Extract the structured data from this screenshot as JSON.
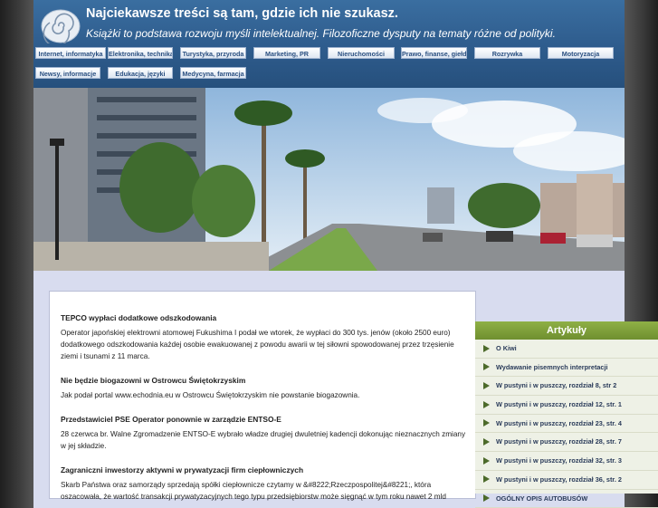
{
  "header": {
    "title": "Najciekawsze treści są tam, gdzie ich nie szukasz.",
    "tagline": "Książki to podstawa rozwoju myśli intelektualnej. Filozoficzne dysputy na tematy różne od polityki.",
    "nav_row1": [
      "Internet, informatyka",
      "Elektronika, technika",
      "Turystyka, przyroda",
      "Marketing, PR",
      "Nieruchomości",
      "Prawo, finanse, giełda",
      "Rozrywka",
      "Motoryzacja"
    ],
    "nav_row2": [
      "Newsy, informacje",
      "Edukacja, języki",
      "Medycyna, farmacja"
    ]
  },
  "articles": [
    {
      "title": "TEPCO wypłaci dodatkowe odszkodowania",
      "body": "Operator japońskiej elektrowni atomowej Fukushima I podał we wtorek, że wypłaci do 300 tys. jenów (około 2500 euro) dodatkowego odszkodowania każdej osobie ewakuowanej z powodu awarii w tej siłowni spowodowanej przez trzęsienie ziemi i tsunami z 11 marca."
    },
    {
      "title": "Nie będzie biogazowni w Ostrowcu Świętokrzyskim",
      "body": "Jak podał portal www.echodnia.eu w Ostrowcu Świętokrzyskim nie powstanie biogazownia."
    },
    {
      "title": "Przedstawiciel PSE Operator ponownie w zarządzie ENTSO-E",
      "body": "28 czerwca br. Walne Zgromadzenie ENTSO-E wybrało władze drugiej dwuletniej kadencji dokonując nieznacznych zmiany w jej składzie."
    },
    {
      "title": "Zagraniczni inwestorzy aktywni w prywatyzacji firm ciepłowniczych",
      "body": "Skarb Państwa oraz samorządy sprzedają spółki ciepłownicze czytamy w &#8222;Rzeczpospolitej&#8221;, która oszacowała, że wartość transakcji prywatyzacyjnych tego typu przedsiębiorstw może sięgnąć w tym roku nawet 2 mld"
    }
  ],
  "sidebar": {
    "heading": "Artykuły",
    "items": [
      "O Kiwi",
      "Wydawanie pisemnych interpretacji",
      "W pustyni i w puszczy, rozdział 8, str 2",
      "W pustyni i w puszczy, rozdział 12, str. 1",
      "W pustyni i w puszczy, rozdział 23, str. 4",
      "W pustyni i w puszczy, rozdział 28, str. 7",
      "W pustyni i w puszczy, rozdział 32, str. 3",
      "W pustyni i w puszczy, rozdział 36, str. 2",
      "OGÓLNY OPIS AUTOBUSÓW"
    ]
  },
  "colors": {
    "header": "#2f5d8e",
    "accent": "#7ea03a",
    "page_bg": "#d8dcef"
  }
}
